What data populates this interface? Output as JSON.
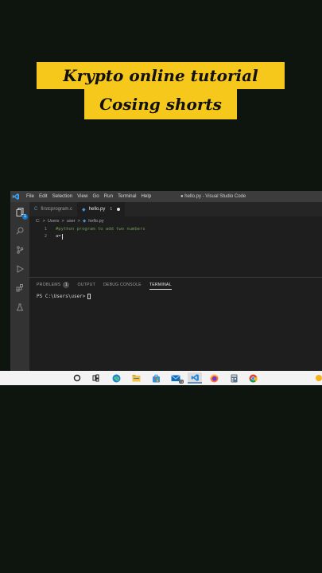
{
  "banner": {
    "line1": "Krypto online tutorial",
    "line2": "Cosing shorts"
  },
  "vscode": {
    "menu": [
      "File",
      "Edit",
      "Selection",
      "View",
      "Go",
      "Run",
      "Terminal",
      "Help"
    ],
    "window_title": "● hello.py - Visual Studio Code",
    "activity_badge": "1",
    "tabs": [
      {
        "label": "firstcprogram.c",
        "icon": "C",
        "icon_color": "#519aba"
      },
      {
        "label": "hello.py",
        "icon": "◆",
        "icon_color": "#3572a5",
        "modified_marker": "1"
      }
    ],
    "breadcrumb": [
      "C:",
      ">",
      "Users",
      ">",
      "user",
      ">",
      "hello.py"
    ],
    "editor": {
      "lines": [
        {
          "number": "1",
          "text": "#python program to add two numbers"
        },
        {
          "number": "2",
          "text": "a="
        }
      ]
    },
    "panel": {
      "tabs": [
        "PROBLEMS",
        "OUTPUT",
        "DEBUG CONSOLE",
        "TERMINAL"
      ],
      "problems_count": "1",
      "active_tab": "TERMINAL",
      "terminal_prompt": "PS C:\\Users\\user>"
    }
  },
  "taskbar": {
    "items": [
      "search-icon",
      "task-view-icon",
      "edge-icon",
      "file-explorer-icon",
      "store-icon",
      "mail-icon",
      "vscode-icon",
      "firefox-icon",
      "calculator-icon",
      "chrome-icon"
    ],
    "mail_badge": "73"
  },
  "colors": {
    "banner": "#f7c81c",
    "background": "#0e140e",
    "accent": "#0e7ad3"
  }
}
